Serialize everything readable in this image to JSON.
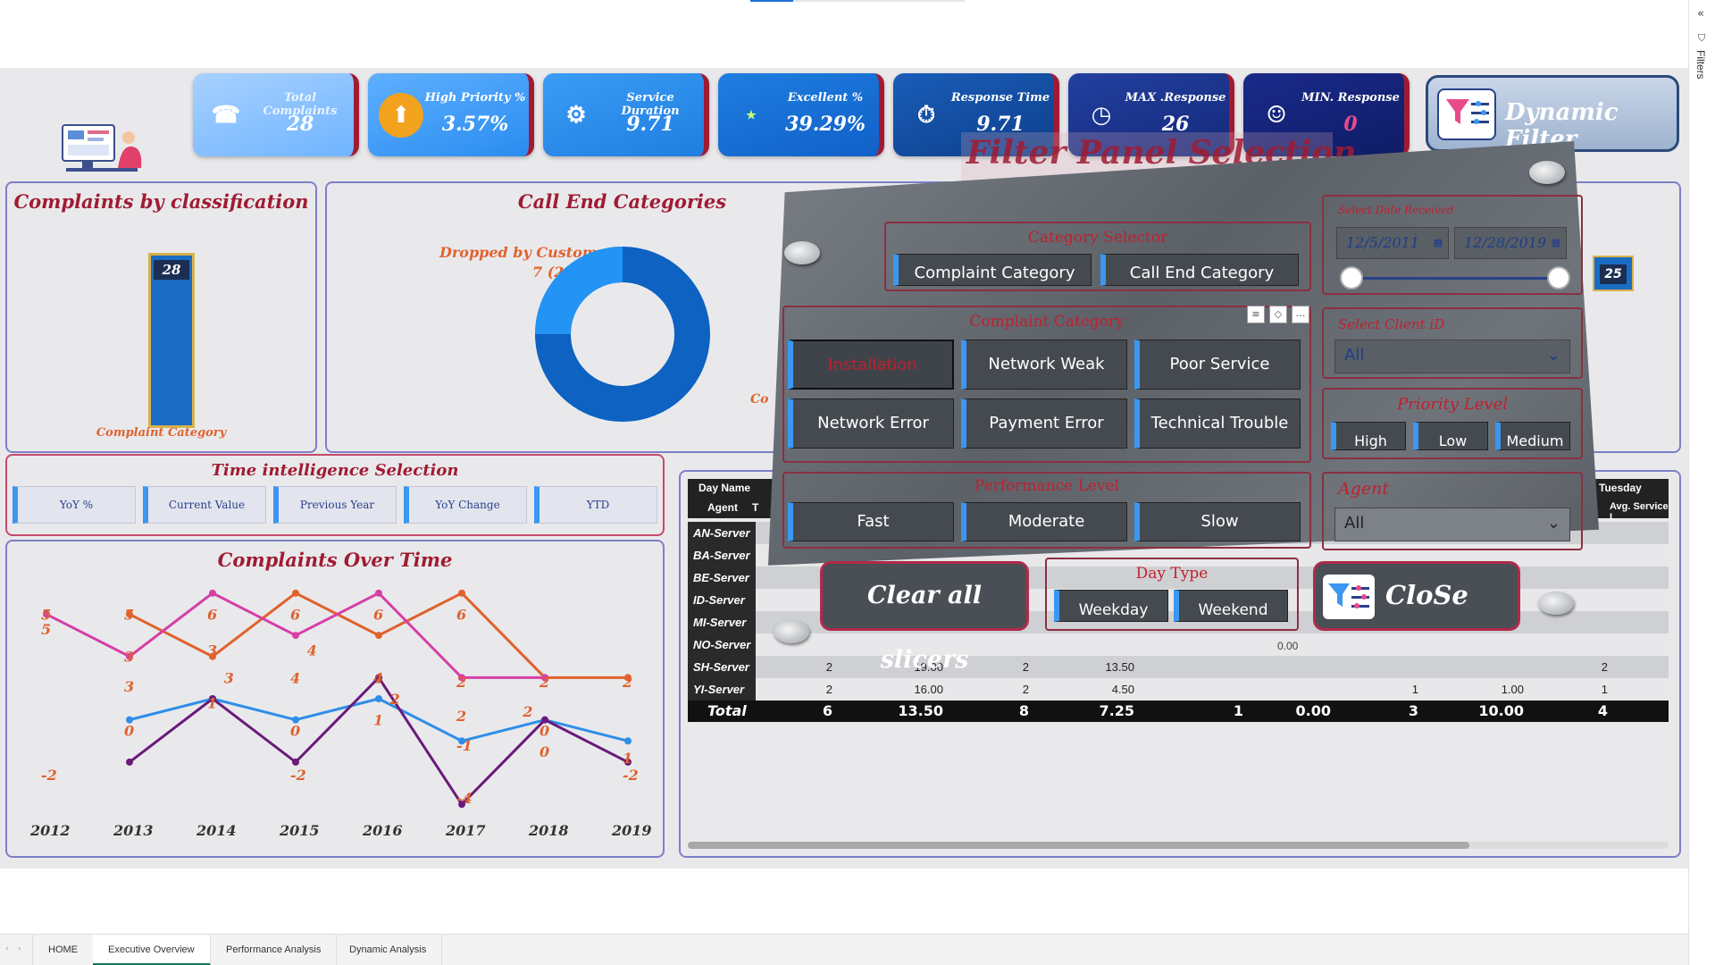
{
  "kpis": [
    {
      "title": "Total Complaints",
      "value": "28",
      "icon": "phone-911-icon"
    },
    {
      "title": "High Priority %",
      "value": "3.57%",
      "icon": "priority-arrow-icon"
    },
    {
      "title": "Service Duration",
      "value": "9.71",
      "icon": "hand-gear-icon"
    },
    {
      "title": "Excellent %",
      "value": "39.29%",
      "icon": "great-badge-icon"
    },
    {
      "title": "Response Time",
      "value": "9.71",
      "icon": "stopwatch-icon"
    },
    {
      "title": "MAX .Response",
      "value": "26",
      "icon": "timer-icon"
    },
    {
      "title": "MIN. Response",
      "value": "0",
      "icon": "network-people-icon"
    }
  ],
  "dynamic_filter": {
    "label": "Dynamic Filter"
  },
  "overlay_title": "Filter Panel Selection",
  "classification": {
    "title": "Complaints by classification",
    "value": "28",
    "axis": "Complaint Category"
  },
  "call_end": {
    "title": "Call End Categories",
    "label_name": "Dropped by Customer",
    "label_val": "7 (25%)",
    "cut_label": "Co"
  },
  "hidden_badge": "25",
  "time_intel": {
    "title": "Time intelligence Selection",
    "buttons": [
      "YoY %",
      "Current Value",
      "Previous Year",
      "YoY Change",
      "YTD"
    ]
  },
  "over_time": {
    "title": "Complaints Over Time"
  },
  "chart_data": {
    "type": "line",
    "title": "Complaints Over Time",
    "x": [
      "2012",
      "2013",
      "2014",
      "2015",
      "2016",
      "2017",
      "2018",
      "2019"
    ],
    "series": [
      {
        "name": "",
        "color": "#e0622d",
        "values": [
          null,
          5,
          3,
          6,
          4,
          6,
          2,
          2
        ]
      },
      {
        "name": "",
        "color": "#d63fa6",
        "values": [
          5,
          3,
          6,
          4,
          6,
          2,
          2,
          null
        ]
      },
      {
        "name": "",
        "color": "#2e8ee8",
        "values": [
          null,
          0,
          1,
          0,
          1,
          -1,
          0,
          -1
        ]
      },
      {
        "name": "",
        "color": "#6a1a7a",
        "values": [
          null,
          -2,
          1,
          -2,
          2,
          -4,
          0,
          -2
        ]
      }
    ],
    "labels": [
      {
        "t": "5",
        "x": 0,
        "y": 5
      },
      {
        "t": "5",
        "x": 0,
        "y": 4.3
      },
      {
        "t": "5",
        "x": 1,
        "y": 5
      },
      {
        "t": "3",
        "x": 1,
        "y": 3
      },
      {
        "t": "3",
        "x": 1,
        "y": 1.6
      },
      {
        "t": "6",
        "x": 2,
        "y": 5
      },
      {
        "t": "3",
        "x": 2,
        "y": 3.3
      },
      {
        "t": "3",
        "x": 2.2,
        "y": 2.0
      },
      {
        "t": "1",
        "x": 2,
        "y": 0.8
      },
      {
        "t": "6",
        "x": 3,
        "y": 5
      },
      {
        "t": "4",
        "x": 3.2,
        "y": 3.3
      },
      {
        "t": "4",
        "x": 3,
        "y": 2.0
      },
      {
        "t": "0",
        "x": 3,
        "y": -0.5
      },
      {
        "t": "-2",
        "x": 3,
        "y": -2.6
      },
      {
        "t": "6",
        "x": 4,
        "y": 5
      },
      {
        "t": "4",
        "x": 4,
        "y": 2.0
      },
      {
        "t": "2",
        "x": 4.2,
        "y": 1.0
      },
      {
        "t": "1",
        "x": 4,
        "y": 0.0
      },
      {
        "t": "6",
        "x": 5,
        "y": 5
      },
      {
        "t": "2",
        "x": 5,
        "y": 1.8
      },
      {
        "t": "2",
        "x": 5,
        "y": 0.2
      },
      {
        "t": "-1",
        "x": 5,
        "y": -1.2
      },
      {
        "t": "-4",
        "x": 5,
        "y": -3.7
      },
      {
        "t": "2",
        "x": 6,
        "y": 1.8
      },
      {
        "t": "2",
        "x": 5.8,
        "y": 0.4
      },
      {
        "t": "0",
        "x": 6,
        "y": -0.5
      },
      {
        "t": "0",
        "x": 6,
        "y": -1.5
      },
      {
        "t": "2",
        "x": 7,
        "y": 1.8
      },
      {
        "t": "1",
        "x": 7,
        "y": -1.8
      },
      {
        "t": "-2",
        "x": 7,
        "y": -2.6
      },
      {
        "t": "-2",
        "x": 0,
        "y": -2.6
      },
      {
        "t": "0",
        "x": 1,
        "y": -0.5
      }
    ]
  },
  "table": {
    "header_top": [
      "Day Name",
      "Tuesday"
    ],
    "header_row": [
      "Agent",
      "T",
      "Avg. Service I"
    ],
    "agents": [
      "AN-Server",
      "BA-Server",
      "BE-Server",
      "ID-Server",
      "MI-Server",
      "NO-Server",
      "SH-Server",
      "YI-Server"
    ],
    "rows": [
      [
        "2",
        "19.00",
        "2",
        "13.50",
        "",
        "",
        "",
        "",
        "2"
      ],
      [
        "2",
        "16.00",
        "2",
        "4.50",
        "",
        "",
        "1",
        "1.00",
        "1"
      ]
    ],
    "partial": "0.00",
    "total": [
      "Total",
      "6",
      "13.50",
      "8",
      "7.25",
      "1",
      "0.00",
      "3",
      "10.00",
      "4"
    ]
  },
  "filter_panel": {
    "category_selector": {
      "title": "Category Selector",
      "items": [
        "Complaint Category",
        "Call End Category"
      ]
    },
    "complaint_category": {
      "title": "Complaint Category",
      "items": [
        "Installation",
        "Network Weak",
        "Poor Service",
        "Network Error",
        "Payment Error",
        "Technical Trouble"
      ]
    },
    "performance": {
      "title": "Performance Level",
      "items": [
        "Fast",
        "Moderate",
        "Slow"
      ]
    },
    "date": {
      "title": "Select Date Received",
      "start": "12/5/2011",
      "end": "12/28/2019"
    },
    "client": {
      "title": "Select Client iD",
      "value": "All"
    },
    "priority": {
      "title": "Priority Level",
      "items": [
        "High",
        "Low",
        "Medium"
      ]
    },
    "agent": {
      "title": "Agent",
      "value": "All"
    },
    "day_type": {
      "title": "Day Type",
      "items": [
        "Weekday",
        "Weekend"
      ]
    },
    "clear": "Clear all slicers",
    "close": "CloSe"
  },
  "pages": [
    "HOME",
    "Executive Overview",
    "Performance Analysis",
    "Dynamic Analysis"
  ],
  "filters_label": "Filters"
}
